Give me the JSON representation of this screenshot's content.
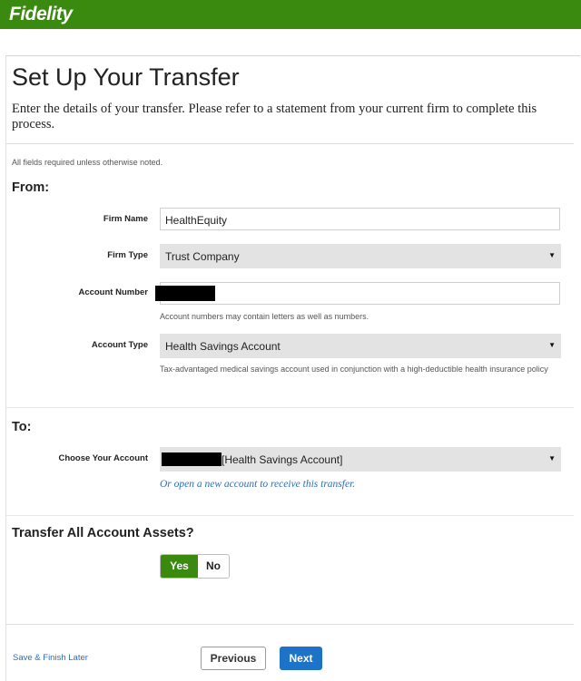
{
  "header": {
    "logo_text": "Fidelity",
    "brand_color": "#3b8a10"
  },
  "page": {
    "title": "Set Up Your Transfer",
    "intro": "Enter the details of your transfer. Please refer to a statement from your current firm to complete this process.",
    "required_note": "All fields required unless otherwise noted."
  },
  "from": {
    "heading": "From:",
    "firm_name": {
      "label": "Firm Name",
      "value": "HealthEquity"
    },
    "firm_type": {
      "label": "Firm Type",
      "value": "Trust Company"
    },
    "account_number": {
      "label": "Account Number",
      "helper": "Account numbers may contain letters as well as numbers."
    },
    "account_type": {
      "label": "Account Type",
      "value": "Health Savings Account",
      "helper": "Tax-advantaged medical savings account used in conjunction with a high-deductible health insurance policy"
    }
  },
  "to": {
    "heading": "To:",
    "choose_account": {
      "label": "Choose Your Account",
      "value": "[Health Savings Account]"
    },
    "open_new_link": "Or open a new account to receive this transfer."
  },
  "transfer_all": {
    "heading": "Transfer All Account Assets?",
    "yes_label": "Yes",
    "no_label": "No",
    "selected": "Yes"
  },
  "footer": {
    "save_later": "Save & Finish Later",
    "previous": "Previous",
    "next": "Next"
  },
  "icons": {
    "select_caret": "caret-down-icon"
  },
  "colors": {
    "link": "#2a6ebb",
    "next_button": "#1c73c8"
  }
}
